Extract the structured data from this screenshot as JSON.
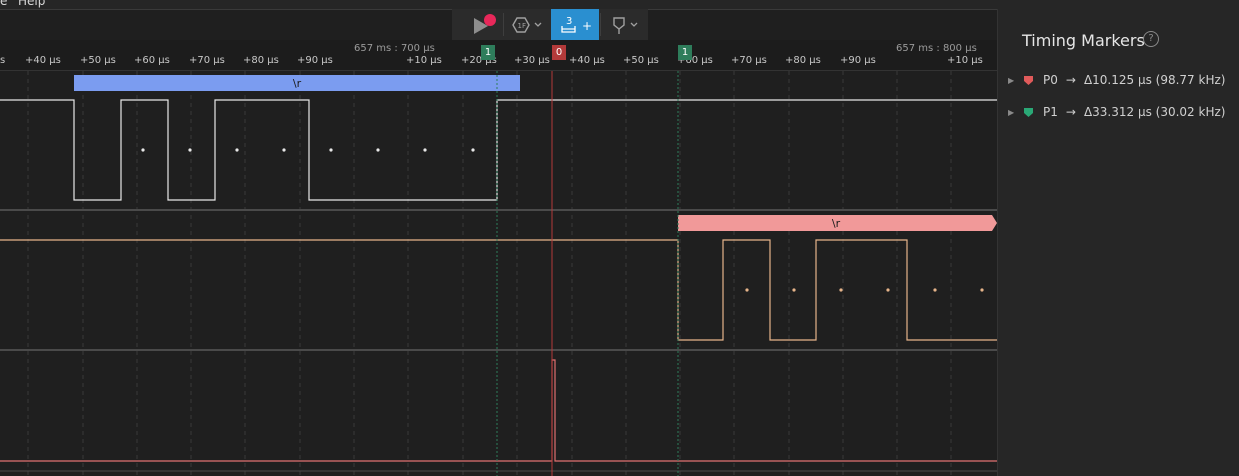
{
  "menubar": {
    "items": [
      "e",
      "Help"
    ]
  },
  "toolbar": {
    "play": "play-icon",
    "trigger": "trigger-settings-icon",
    "measure_label": "3",
    "measure_plus": "+",
    "marker": "timing-marker-icon"
  },
  "ruler": {
    "ticks": [
      "s",
      "+40 µs",
      "+50 µs",
      "+60 µs",
      "+70 µs",
      "+80 µs",
      "+90 µs",
      "+10 µs",
      "+20 µs",
      "+30 µs",
      "+40 µs",
      "+50 µs",
      "+60 µs",
      "+70 µs",
      "+80 µs",
      "+90 µs",
      "+10 µs"
    ],
    "time_labels": [
      "657 ms : 700 µs",
      "657 ms : 800 µs"
    ],
    "flags": [
      {
        "label": "1",
        "color": "#2e7d5b"
      },
      {
        "label": "0",
        "color": "#b33a3a"
      },
      {
        "label": "1",
        "color": "#2e7d5b"
      }
    ]
  },
  "channels": [
    {
      "decode": "\\r",
      "decode_color": "#7b9cf0",
      "line_color": "#e8e8e8"
    },
    {
      "decode": "\\r",
      "decode_color": "#f19999",
      "line_color": "#e6b48a"
    },
    {
      "line_color": "#e07070"
    }
  ],
  "panel": {
    "title": "Timing Markers",
    "help": "?",
    "markers": [
      {
        "name": "P0",
        "delta": "Δ10.125 µs (98.77 kHz)",
        "color": "#e05a5a"
      },
      {
        "name": "P1",
        "delta": "Δ33.312 µs (30.02 kHz)",
        "color": "#2aa876"
      }
    ]
  }
}
